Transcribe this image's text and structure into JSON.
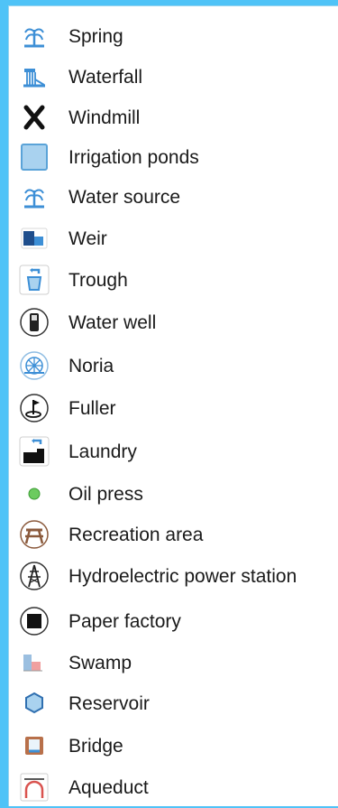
{
  "legend": {
    "items": [
      {
        "label": "Spring",
        "icon": "fountain-icon"
      },
      {
        "label": "Waterfall",
        "icon": "waterfall-icon"
      },
      {
        "label": "Windmill",
        "icon": "windmill-icon"
      },
      {
        "label": "Irrigation ponds",
        "icon": "pond-square-icon"
      },
      {
        "label": "Water source",
        "icon": "fountain-icon"
      },
      {
        "label": "Weir",
        "icon": "weir-icon"
      },
      {
        "label": "Trough",
        "icon": "trough-icon"
      },
      {
        "label": "Water well",
        "icon": "well-icon"
      },
      {
        "label": "Noria",
        "icon": "noria-icon"
      },
      {
        "label": "Fuller",
        "icon": "fuller-icon"
      },
      {
        "label": "Laundry",
        "icon": "laundry-icon"
      },
      {
        "label": "Oil press",
        "icon": "green-dot-icon"
      },
      {
        "label": "Recreation area",
        "icon": "picnic-table-icon"
      },
      {
        "label": "Hydroelectric power station",
        "icon": "power-tower-icon"
      },
      {
        "label": "Paper factory",
        "icon": "black-square-icon"
      },
      {
        "label": "Swamp",
        "icon": "swamp-icon"
      },
      {
        "label": "Reservoir",
        "icon": "hexagon-icon"
      },
      {
        "label": "Bridge",
        "icon": "bridge-icon"
      },
      {
        "label": "Aqueduct",
        "icon": "arch-icon"
      }
    ]
  },
  "colors": {
    "background": "#4fc3f7",
    "panel": "#ffffff",
    "water_blue": "#3d8fd6",
    "pale_blue": "#a9d2ef",
    "green": "#6ccb5f",
    "brown": "#8b5a3c",
    "red_arch": "#d9534f"
  }
}
